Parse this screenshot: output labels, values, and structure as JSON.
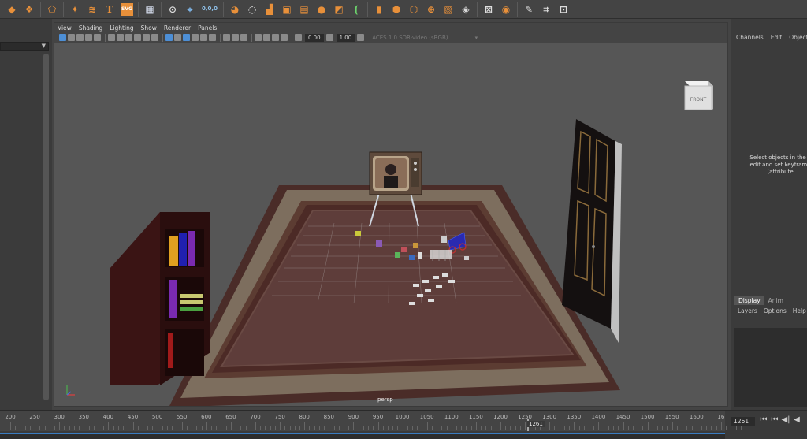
{
  "shelf": {
    "icons": [
      "poly-shape-icon",
      "cluster-icon",
      "paint-effects-icon",
      "star-icon",
      "curve-icon",
      "text-tool-icon",
      "svg-tool-icon",
      "calculator-icon",
      "measure-icon",
      "locator-icon",
      "distance-icon",
      "bevel-icon",
      "bridge-icon",
      "extrude-icon",
      "combine-icon",
      "smooth-icon",
      "booleans-icon",
      "mirror-icon",
      "uv-editor-icon",
      "cube-icon",
      "cube-multi-icon",
      "sphere-grid-icon",
      "cut-icon",
      "cube-outline-icon",
      "pen-icon",
      "lattice-icon",
      "extra-icon"
    ],
    "text_icons": {
      "text": "T",
      "svg": "SVG",
      "coord": "0,0,0"
    }
  },
  "viewport": {
    "menu": [
      "View",
      "Shading",
      "Lighting",
      "Show",
      "Renderer",
      "Panels"
    ],
    "exposure": "0.00",
    "gamma": "1.00",
    "color_space": "ACES 1.0 SDR-video (sRGB)",
    "camera": "persp",
    "view_cube": "FRONT"
  },
  "channel_box": {
    "menu": [
      "Channels",
      "Edit",
      "Object"
    ],
    "message_lines": [
      "Select objects in the s",
      "edit and set keyframe",
      "(attribute"
    ]
  },
  "layer_editor": {
    "tabs": [
      "Display",
      "Anim"
    ],
    "menu": [
      "Layers",
      "Options",
      "Help"
    ]
  },
  "timeline": {
    "ticks": [
      "200",
      "250",
      "300",
      "350",
      "400",
      "450",
      "500",
      "550",
      "600",
      "650",
      "700",
      "750",
      "800",
      "850",
      "900",
      "950",
      "1000",
      "1050",
      "1100",
      "1150",
      "1200",
      "1250",
      "1300",
      "1350",
      "1400",
      "1450",
      "1500",
      "1550",
      "1600",
      "16"
    ],
    "current_frame": "1261",
    "frame_field": "1261",
    "controls": [
      "⏮",
      "⏮",
      "◀|",
      "◀"
    ]
  },
  "colors": {
    "accent": "#4d8fd6",
    "shelf_orange": "#e8903a",
    "timeline_blue": "#3a7bbf"
  }
}
